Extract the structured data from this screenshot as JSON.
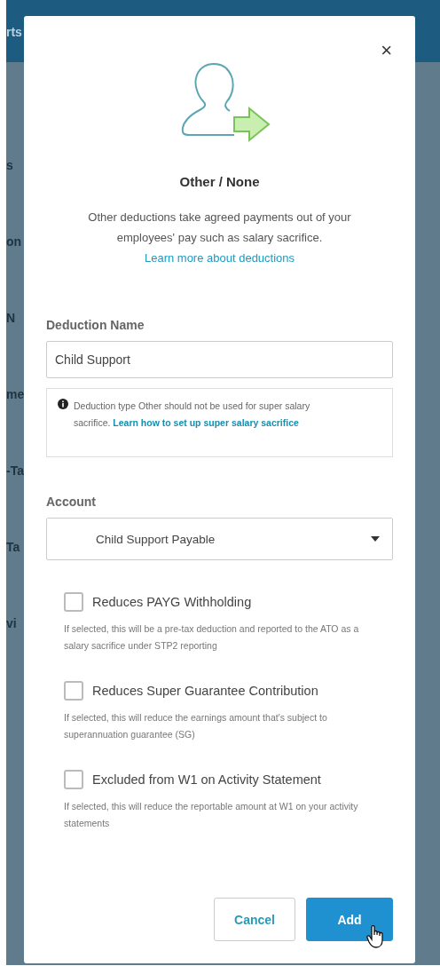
{
  "background": {
    "fragments": [
      {
        "text": "rts"
      },
      {
        "text": "s"
      },
      {
        "text": "on"
      },
      {
        "text": "N"
      },
      {
        "text": "me"
      },
      {
        "text": "-Ta"
      },
      {
        "text": "Ta"
      },
      {
        "text": "vi"
      }
    ]
  },
  "dialog": {
    "close": "×",
    "title": "Other / None",
    "description": "Other deductions take agreed payments out of your employees' pay such as salary sacrifice.",
    "description_link": "Learn more about deductions",
    "name_field": {
      "label": "Deduction Name",
      "value": "Child Support"
    },
    "notice": {
      "text": "Deduction type Other should not be used for super salary sacrifice.",
      "link": "Learn how to set up super salary sacrifice"
    },
    "account_field": {
      "label": "Account",
      "value": "Child Support Payable"
    },
    "options": [
      {
        "label": "Reduces PAYG Withholding",
        "checked": false,
        "help": "If selected, this will be a pre-tax deduction and reported to the ATO as a salary sacrifice under STP2 reporting"
      },
      {
        "label": "Reduces Super Guarantee Contribution",
        "checked": false,
        "help": "If selected, this will reduce the earnings amount that's subject to superannuation guarantee (SG)"
      },
      {
        "label": "Excluded from W1 on Activity Statement",
        "checked": false,
        "help": "If selected, this will reduce the reportable amount at W1 on your activity statements"
      }
    ],
    "buttons": [
      {
        "label": "Cancel",
        "kind": "secondary"
      },
      {
        "label": "Add",
        "kind": "primary"
      }
    ]
  }
}
